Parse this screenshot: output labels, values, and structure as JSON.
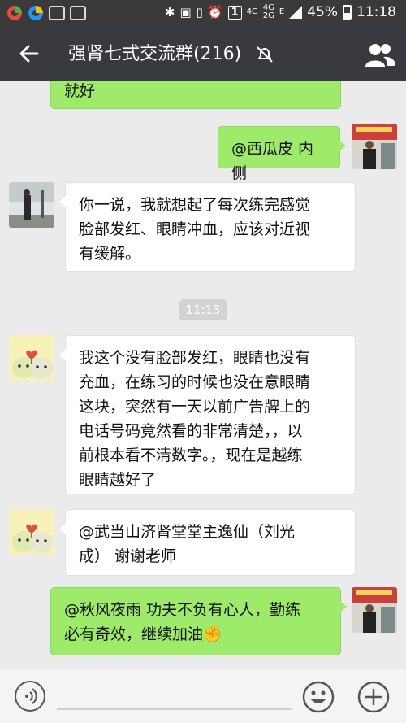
{
  "status_bar": {
    "network_top": "4G",
    "network_bottom": "4G\n2G",
    "e_label": "E",
    "sim_slot": "1",
    "battery": "45%",
    "time": "11:18"
  },
  "header": {
    "title": "强肾七式交流群(216)"
  },
  "messages": [
    {
      "side": "out",
      "text": "就好"
    },
    {
      "side": "out",
      "text": "@西瓜皮 内侧"
    },
    {
      "side": "in",
      "lines": [
        "你一说，我就想起了每次练完感觉",
        "脸部发红、眼睛冲血，应该对近视",
        "有缓解。"
      ]
    },
    {
      "side": "in",
      "lines": [
        "我这个没有脸部发红，眼睛也没有",
        "充血，在练习的时候也没在意眼睛",
        "这块，突然有一天以前广告牌上的",
        "电话号码竟然看的非常清楚，，以",
        "前根本看不清数字。，现在是越练",
        "眼睛越好了"
      ]
    },
    {
      "side": "in",
      "lines": [
        "@武当山济肾堂堂主逸仙（刘光",
        "成） 谢谢老师"
      ]
    },
    {
      "side": "out",
      "lines": [
        "@秋风夜雨 功夫不负有心人，勤练",
        "必有奇效，继续加油✊"
      ]
    }
  ],
  "timestamp": "11:13",
  "colors": {
    "title_bar": "#393a3f",
    "status_bar": "#3a3a3a",
    "chat_bg": "#ebebeb",
    "bubble_out": "#9eea6a",
    "bubble_in": "#ffffff"
  }
}
